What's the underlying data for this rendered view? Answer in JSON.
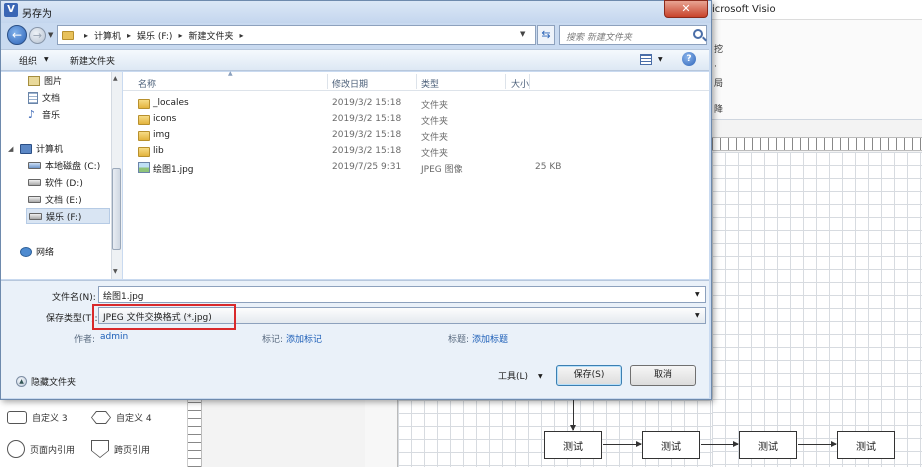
{
  "visio": {
    "title": "icrosoft Visio",
    "ribbon_items": [
      "挖",
      "·",
      "局",
      "降"
    ],
    "shapes": [
      {
        "label": "自定义 3",
        "shape": "rect"
      },
      {
        "label": "自定义 4",
        "shape": "hex"
      },
      {
        "label": "页面内引用",
        "shape": "circle"
      },
      {
        "label": "跨页引用",
        "shape": "shield"
      }
    ],
    "flow_boxes": [
      "测试",
      "测试",
      "测试",
      "测试"
    ]
  },
  "dialog": {
    "title": "另存为",
    "title_icon": "V",
    "close_symbol": "✕",
    "address": {
      "crumbs": [
        "计算机",
        "娱乐 (F:)",
        "新建文件夹"
      ],
      "separator": "▸"
    },
    "search_placeholder": "搜索 新建文件夹",
    "toolbar": {
      "organize": "组织",
      "new_folder": "新建文件夹",
      "help": "?"
    },
    "nav": {
      "items": [
        {
          "label": "图片",
          "icon": "library-icon"
        },
        {
          "label": "文档",
          "icon": "document-icon"
        },
        {
          "label": "音乐",
          "icon": "music-icon"
        },
        {
          "label": "计算机",
          "icon": "computer-icon"
        },
        {
          "label": "本地磁盘 (C:)",
          "icon": "drive-icon"
        },
        {
          "label": "软件 (D:)",
          "icon": "drive-icon"
        },
        {
          "label": "文档 (E:)",
          "icon": "drive-icon"
        },
        {
          "label": "娱乐 (F:)",
          "icon": "drive-icon",
          "selected": true
        },
        {
          "label": "网络",
          "icon": "network-icon"
        }
      ]
    },
    "columns": [
      "名称",
      "修改日期",
      "类型",
      "大小"
    ],
    "files": [
      {
        "name": "_locales",
        "date": "2019/3/2 15:18",
        "type": "文件夹",
        "size": "",
        "icon": "folder-icon"
      },
      {
        "name": "icons",
        "date": "2019/3/2 15:18",
        "type": "文件夹",
        "size": "",
        "icon": "folder-icon"
      },
      {
        "name": "img",
        "date": "2019/3/2 15:18",
        "type": "文件夹",
        "size": "",
        "icon": "folder-icon"
      },
      {
        "name": "lib",
        "date": "2019/3/2 15:18",
        "type": "文件夹",
        "size": "",
        "icon": "folder-icon"
      },
      {
        "name": "绘图1.jpg",
        "date": "2019/7/25 9:31",
        "type": "JPEG 图像",
        "size": "25 KB",
        "icon": "image-icon"
      }
    ],
    "form": {
      "filename_label": "文件名(N):",
      "filename_value": "绘图1.jpg",
      "filetype_label": "保存类型(T):",
      "filetype_value": "JPEG 文件交换格式 (*.jpg)",
      "author_label": "作者:",
      "author_value": "admin",
      "tags_label": "标记:",
      "tags_value": "添加标记",
      "title_label": "标题:",
      "title_value": "添加标题"
    },
    "hide_folders": "隐藏文件夹",
    "tools": "工具(L)",
    "save": "保存(S)",
    "cancel": "取消"
  }
}
